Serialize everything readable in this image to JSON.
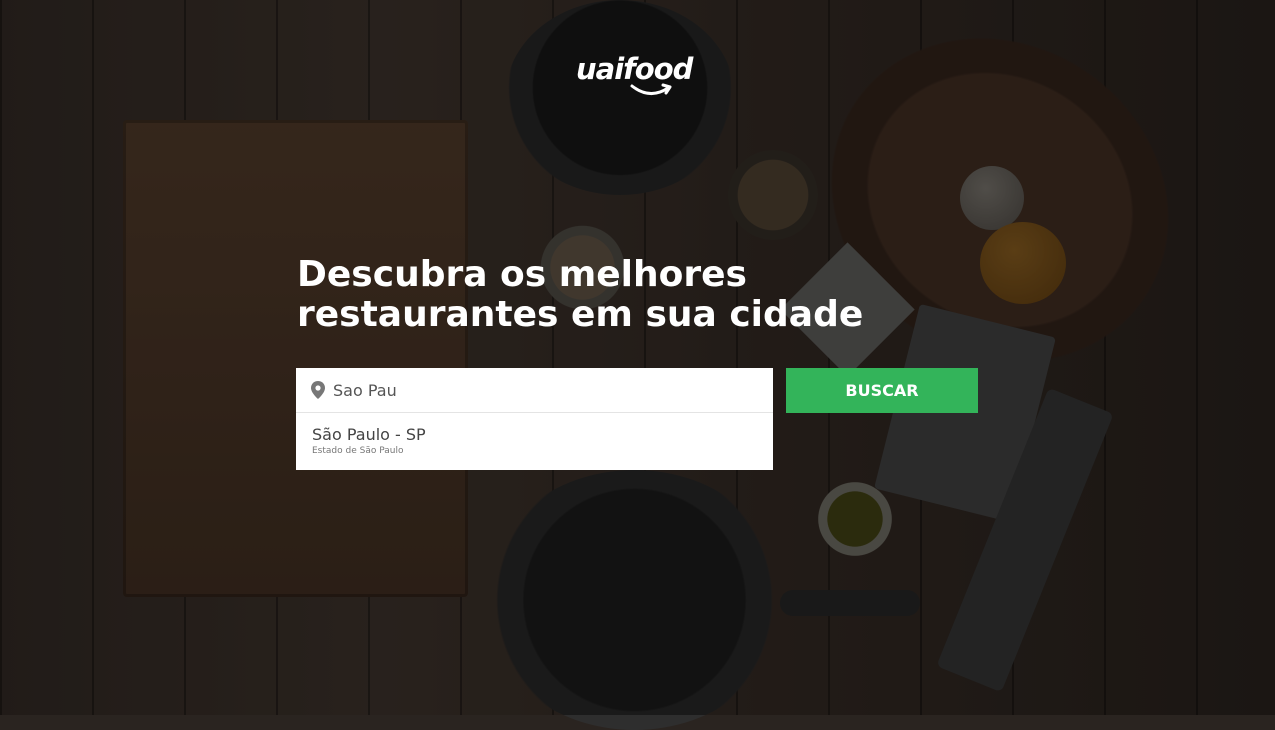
{
  "brand": {
    "name": "uaifood",
    "accent": "#33b45a"
  },
  "hero": {
    "headline_line1": "Descubra os melhores",
    "headline_line2": "restaurantes em sua cidade"
  },
  "search": {
    "icon": "map-pin-icon",
    "value": "Sao Pau",
    "button_label": "BUSCAR"
  },
  "suggestions": [
    {
      "title": "São Paulo - SP",
      "subtitle": "Estado de São Paulo"
    }
  ]
}
